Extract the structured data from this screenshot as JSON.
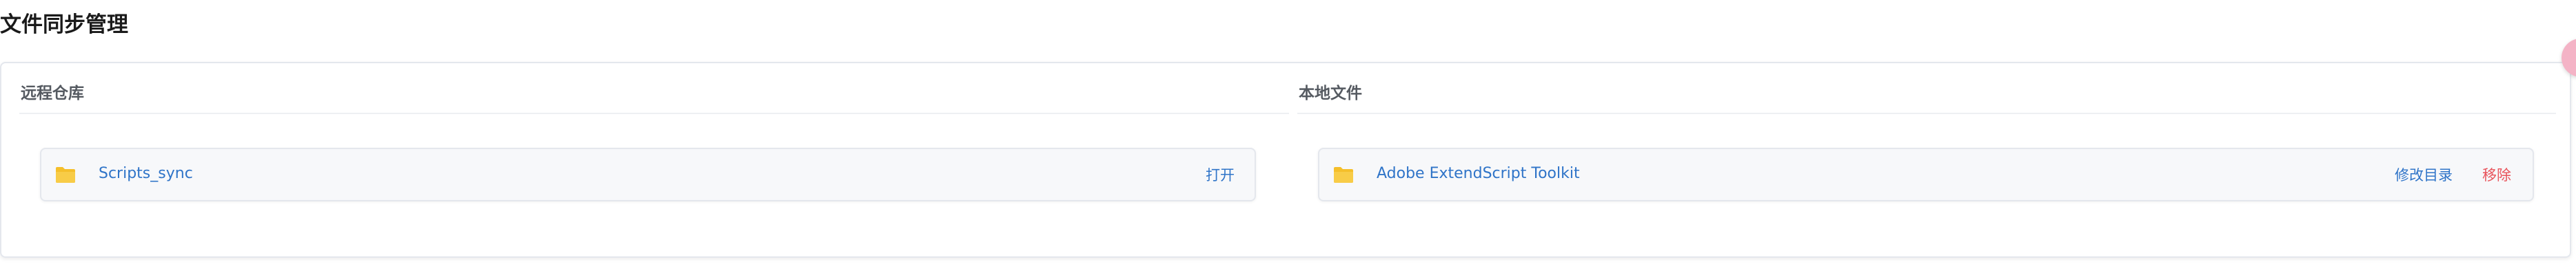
{
  "page": {
    "title": "文件同步管理"
  },
  "remote": {
    "title": "远程仓库",
    "items": [
      {
        "name": "Scripts_sync",
        "icon": "folder-icon",
        "open_label": "打开"
      }
    ]
  },
  "local": {
    "title": "本地文件",
    "items": [
      {
        "name": "Adobe ExtendScript Toolkit",
        "icon": "folder-icon",
        "edit_label": "修改目录",
        "remove_label": "移除"
      }
    ]
  },
  "colors": {
    "link": "#2f74c8",
    "danger": "#e8525a",
    "folder": "#f5bf2a",
    "badge": "#f4b3c6"
  }
}
